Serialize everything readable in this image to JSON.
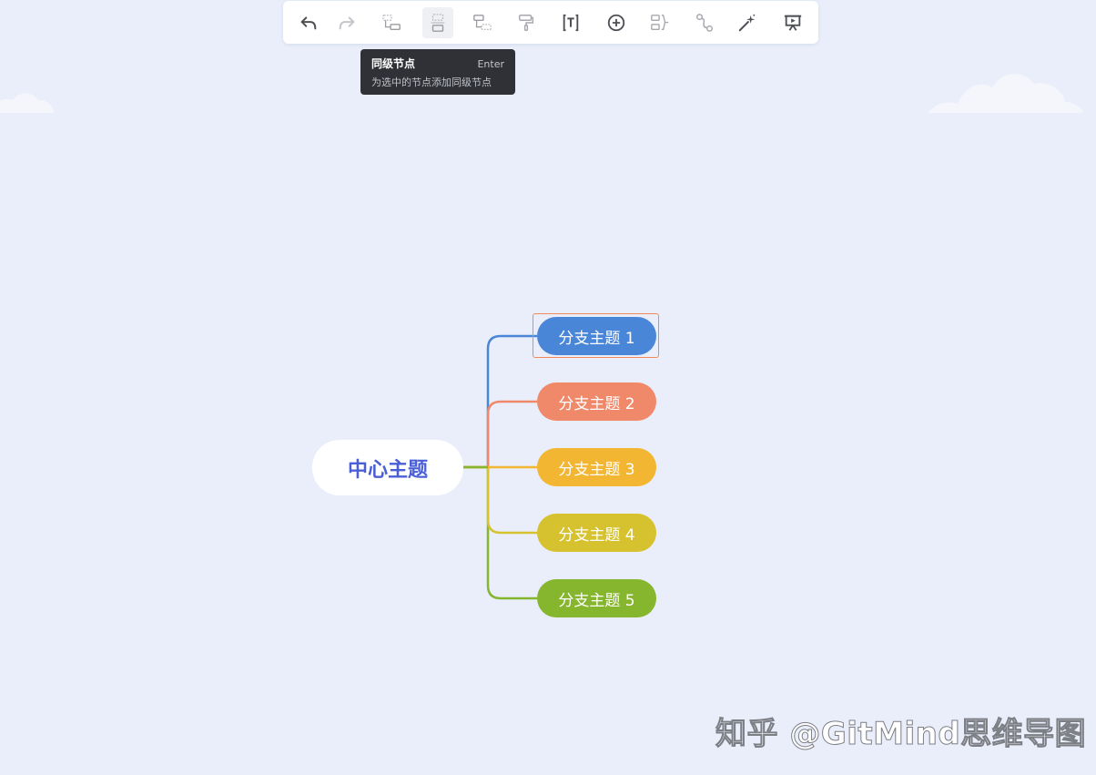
{
  "toolbar": {
    "buttons": [
      {
        "name": "undo-button",
        "icon": "undo-icon",
        "enabled": true,
        "active": false
      },
      {
        "name": "redo-button",
        "icon": "redo-icon",
        "enabled": false,
        "active": false
      },
      {
        "name": "add-child-node-button",
        "icon": "child-node-icon",
        "enabled": false,
        "active": false
      },
      {
        "name": "add-sibling-node-button",
        "icon": "sibling-node-icon",
        "enabled": false,
        "active": true
      },
      {
        "name": "add-parent-node-button",
        "icon": "parent-node-icon",
        "enabled": false,
        "active": false
      },
      {
        "name": "format-painter-button",
        "icon": "paint-roller-icon",
        "enabled": false,
        "active": false
      },
      {
        "name": "text-button",
        "icon": "text-box-icon",
        "enabled": true,
        "active": false
      },
      {
        "name": "insert-button",
        "icon": "plus-circle-icon",
        "enabled": true,
        "active": false
      },
      {
        "name": "summary-button",
        "icon": "summary-bracket-icon",
        "enabled": false,
        "active": false
      },
      {
        "name": "relation-line-button",
        "icon": "relation-link-icon",
        "enabled": false,
        "active": false
      },
      {
        "name": "style-button",
        "icon": "magic-wand-icon",
        "enabled": true,
        "active": false
      },
      {
        "name": "presentation-button",
        "icon": "presentation-icon",
        "enabled": true,
        "active": false
      }
    ]
  },
  "tooltip": {
    "title": "同级节点",
    "shortcut": "Enter",
    "description": "为选中的节点添加同级节点"
  },
  "mindmap": {
    "center": {
      "label": "中心主题",
      "color": "#4a5fd6"
    },
    "branches": [
      {
        "label": "分支主题 1",
        "color": "#4a86d8",
        "selected": true
      },
      {
        "label": "分支主题 2",
        "color": "#f0896a",
        "selected": false
      },
      {
        "label": "分支主题 3",
        "color": "#f2b632",
        "selected": false
      },
      {
        "label": "分支主题 4",
        "color": "#d6c22e",
        "selected": false
      },
      {
        "label": "分支主题 5",
        "color": "#86b52e",
        "selected": false
      }
    ],
    "selection_color": "#f08a5a"
  },
  "watermark": {
    "text": "知乎 @GitMind思维导图"
  },
  "colors": {
    "background": "#e9eefa",
    "toolbar": "#ffffff",
    "tooltip": "#2f3136"
  }
}
